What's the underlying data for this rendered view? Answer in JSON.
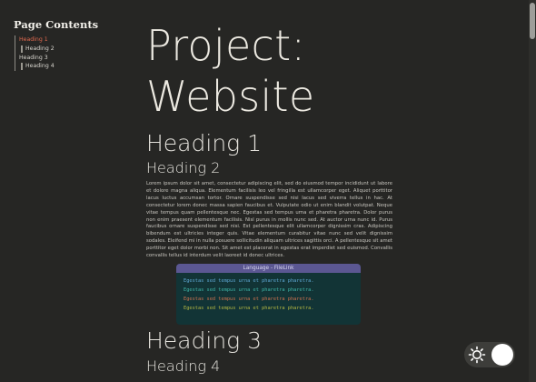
{
  "toc": {
    "title": "Page Contents",
    "items": [
      {
        "label": "Heading 1"
      },
      {
        "label": "Heading 2"
      },
      {
        "label": "Heading 3"
      },
      {
        "label": "Heading 4"
      }
    ]
  },
  "main": {
    "title_line1": "Project:",
    "title_line2": "Website",
    "heading1": "Heading 1",
    "heading2": "Heading 2",
    "paragraph": "Lorem ipsum dolor sit amet, consectetur adipiscing elit, sed do eiusmod tempor incididunt ut labore et dolore magna aliqua. Elementum facilisis leo vel fringilla est ullamcorper eget. Aliquet porttitor lacus luctus accumsan tortor. Ornare suspendisse sed nisi lacus sed viverra tellus in hac. At consectetur lorem donec massa sapien faucibus et. Vulputate odio ut enim blandit volutpat. Neque vitae tempus quam pellentesque nec. Egestas sed tempus urna et pharetra pharetra. Dolor purus non enim praesent elementum facilisis. Nisl purus in mollis nunc sed. At auctor urna nunc id. Purus faucibus ornare suspendisse sed nisi. Est pellentesque elit ullamcorper dignissim cras. Adipiscing bibendum est ultricies integer quis. Vitae elementum curabitur vitae nunc sed velit dignissim sodales. Eleifend mi in nulla posuere sollicitudin aliquam ultrices sagittis orci. A pellentesque sit amet porttitor eget dolor morbi non. Sit amet est placerat in egestas erat imperdiet sed euismod. Convallis convallis tellus id interdum velit laoreet id donec ultrices.",
    "heading3": "Heading 3",
    "heading4": "Heading 4"
  },
  "code_block": {
    "header": "Language - FileLink",
    "lines": [
      {
        "text": "Egestas sed tempus urna et pharetra pharetra.",
        "color": "#5fa9d6"
      },
      {
        "text": "Egestas sed tempus urna et pharetra pharetra.",
        "color": "#3fb6a8"
      },
      {
        "text": "Egestas sed tempus urna et pharetra pharetra.",
        "color": "#d0724f"
      },
      {
        "text": "Egestas sed tempus urna et pharetra pharetra.",
        "color": "#b4b842"
      }
    ]
  },
  "theme_toggle": {
    "icon": "sun-icon",
    "state": "light"
  },
  "colors": {
    "background": "#262624",
    "toc_active": "#e0694f",
    "code_background": "#123436",
    "code_header": "#5b5792"
  }
}
